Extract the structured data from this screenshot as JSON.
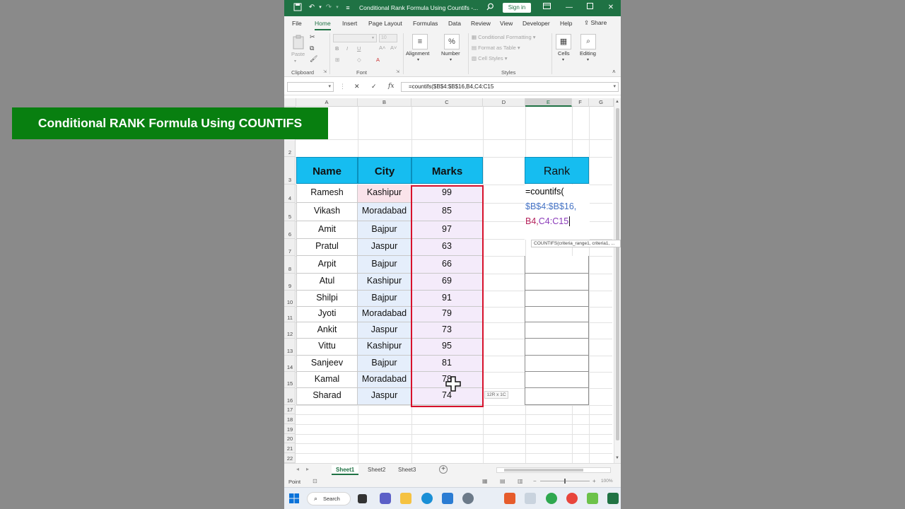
{
  "titlebar": {
    "title": "Conditional Rank Formula Using Countifs -...",
    "signin": "Sign in"
  },
  "ribbon": {
    "tabs": [
      "File",
      "Home",
      "Insert",
      "Page Layout",
      "Formulas",
      "Data",
      "Review",
      "View",
      "Developer",
      "Help"
    ],
    "active_tab": "Home",
    "share": "Share",
    "clipboard": {
      "paste": "Paste",
      "label": "Clipboard"
    },
    "font": {
      "size": "10",
      "label": "Font"
    },
    "alignment": "Alignment",
    "number": "Number",
    "styles": {
      "conditional": "Conditional Formatting",
      "format_table": "Format as Table",
      "cell_styles": "Cell Styles",
      "label": "Styles"
    },
    "cells": "Cells",
    "editing": "Editing"
  },
  "formula_bar": {
    "name_box": "",
    "formula": "=countifs($B$4:$B$16,B4,C4:C15"
  },
  "columns": [
    "A",
    "B",
    "C",
    "D",
    "E",
    "F",
    "G"
  ],
  "rows": [
    "1",
    "2",
    "3",
    "4",
    "5",
    "6",
    "7",
    "8",
    "9",
    "10",
    "11",
    "12",
    "13",
    "14",
    "15",
    "16",
    "17",
    "18",
    "19",
    "20",
    "21",
    "22"
  ],
  "sheet": {
    "title": "Conditional RANK Formula Using COUNTIFS",
    "headers": {
      "name": "Name",
      "city": "City",
      "marks": "Marks",
      "rank": "Rank"
    },
    "data": [
      {
        "name": "Ramesh",
        "city": "Kashipur",
        "marks": "99"
      },
      {
        "name": "Vikash",
        "city": "Moradabad",
        "marks": "85"
      },
      {
        "name": "Amit",
        "city": "Bajpur",
        "marks": "97"
      },
      {
        "name": "Pratul",
        "city": "Jaspur",
        "marks": "63"
      },
      {
        "name": "Arpit",
        "city": "Bajpur",
        "marks": "66"
      },
      {
        "name": "Atul",
        "city": "Kashipur",
        "marks": "69"
      },
      {
        "name": "Shilpi",
        "city": "Bajpur",
        "marks": "91"
      },
      {
        "name": "Jyoti",
        "city": "Moradabad",
        "marks": "79"
      },
      {
        "name": "Ankit",
        "city": "Jaspur",
        "marks": "73"
      },
      {
        "name": "Vittu",
        "city": "Kashipur",
        "marks": "95"
      },
      {
        "name": "Sanjeev",
        "city": "Bajpur",
        "marks": "81"
      },
      {
        "name": "Kamal",
        "city": "Moradabad",
        "marks": "78"
      },
      {
        "name": "Sharad",
        "city": "Jaspur",
        "marks": "74"
      }
    ],
    "edit": {
      "line1": "=countifs(",
      "line2": "$B$4:$B$16,",
      "line3a": "B4,",
      "line3b": "C4:C15"
    },
    "tooltip": "COUNTIFS(criteria_range1, criteria1, ...",
    "size_tip": "12R x 1C"
  },
  "sheet_tabs": [
    "Sheet1",
    "Sheet2",
    "Sheet3"
  ],
  "active_sheet": "Sheet1",
  "status": {
    "mode": "Point",
    "zoom": "100%"
  },
  "taskbar": {
    "search": "Search"
  },
  "colors": {
    "excel_green": "#1f7244",
    "banner": "#087f10",
    "header_cyan": "#16bdf0",
    "selection_red": "#d7112b"
  }
}
